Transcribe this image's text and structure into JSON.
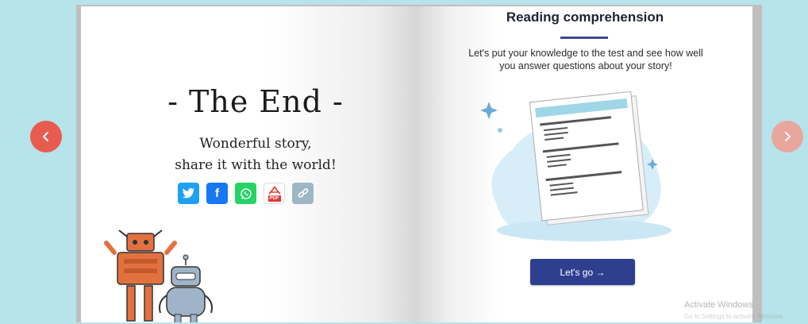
{
  "left_page": {
    "title": "- The End -",
    "subtitle_line1": "Wonderful story,",
    "subtitle_line2": "share it with the world!",
    "share_buttons": [
      {
        "name": "twitter-icon",
        "color": "#1da1f2"
      },
      {
        "name": "facebook-icon",
        "color": "#1877f2",
        "glyph": "f"
      },
      {
        "name": "whatsapp-icon",
        "color": "#25d366"
      },
      {
        "name": "pdf-icon",
        "color": "#e53935",
        "glyph": "PDF"
      },
      {
        "name": "link-icon",
        "color": "#9eb7c6"
      }
    ]
  },
  "right_page": {
    "title": "Reading comprehension",
    "description_line1": "Let's put your knowledge to the test and see how well",
    "description_line2": "you answer questions about your story!",
    "button_label": "Let's go →",
    "accent_color": "#2f3f8f"
  },
  "navigation": {
    "prev_color": "#e85c4f",
    "next_color": "#e9a69d"
  },
  "watermark": {
    "line1": "Activate Windows",
    "line2": "Go to Settings to activate Windows."
  }
}
